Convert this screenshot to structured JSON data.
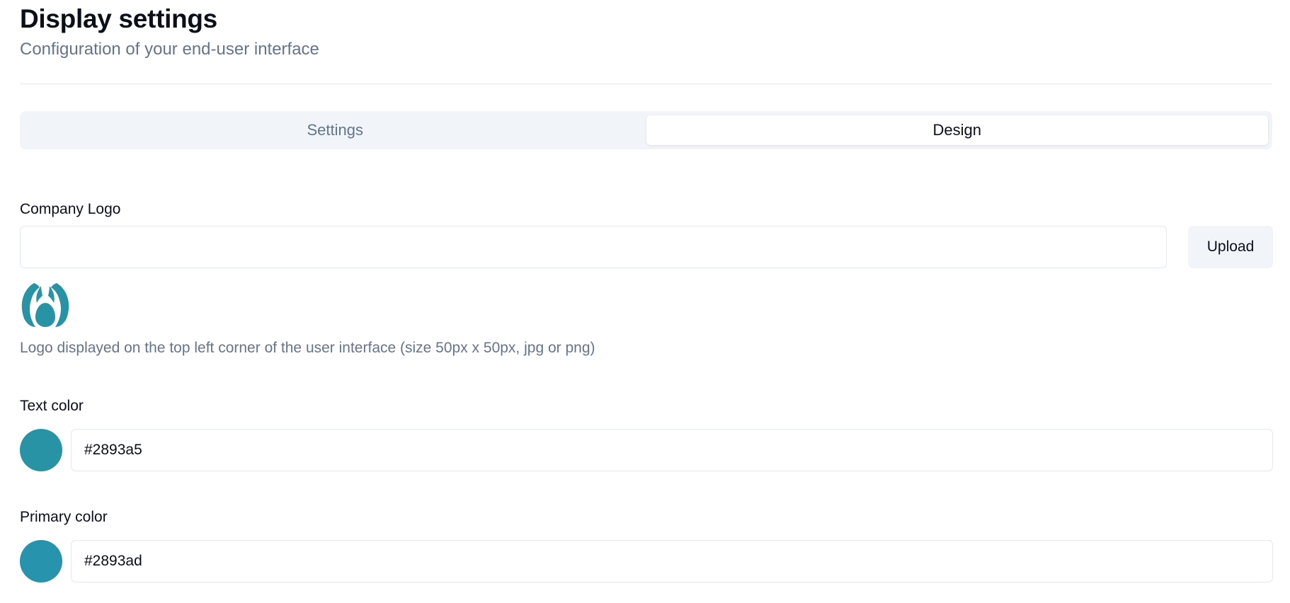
{
  "header": {
    "title": "Display settings",
    "subtitle": "Configuration of your end-user interface"
  },
  "tabs": [
    {
      "label": "Settings",
      "active": false
    },
    {
      "label": "Design",
      "active": true
    }
  ],
  "company_logo": {
    "label": "Company Logo",
    "value": "",
    "upload_label": "Upload",
    "logo_icon": "drop-petal-logo-icon",
    "help_text": "Logo displayed on the top left corner of the user interface (size 50px x 50px, jpg or png)"
  },
  "text_color": {
    "label": "Text color",
    "value": "#2893a5"
  },
  "primary_color": {
    "label": "Primary color",
    "value": "#2893ad"
  },
  "colors": {
    "logo": "#2893a5",
    "tab_bar_bg": "#f1f5f9",
    "muted_text": "#64748b"
  }
}
